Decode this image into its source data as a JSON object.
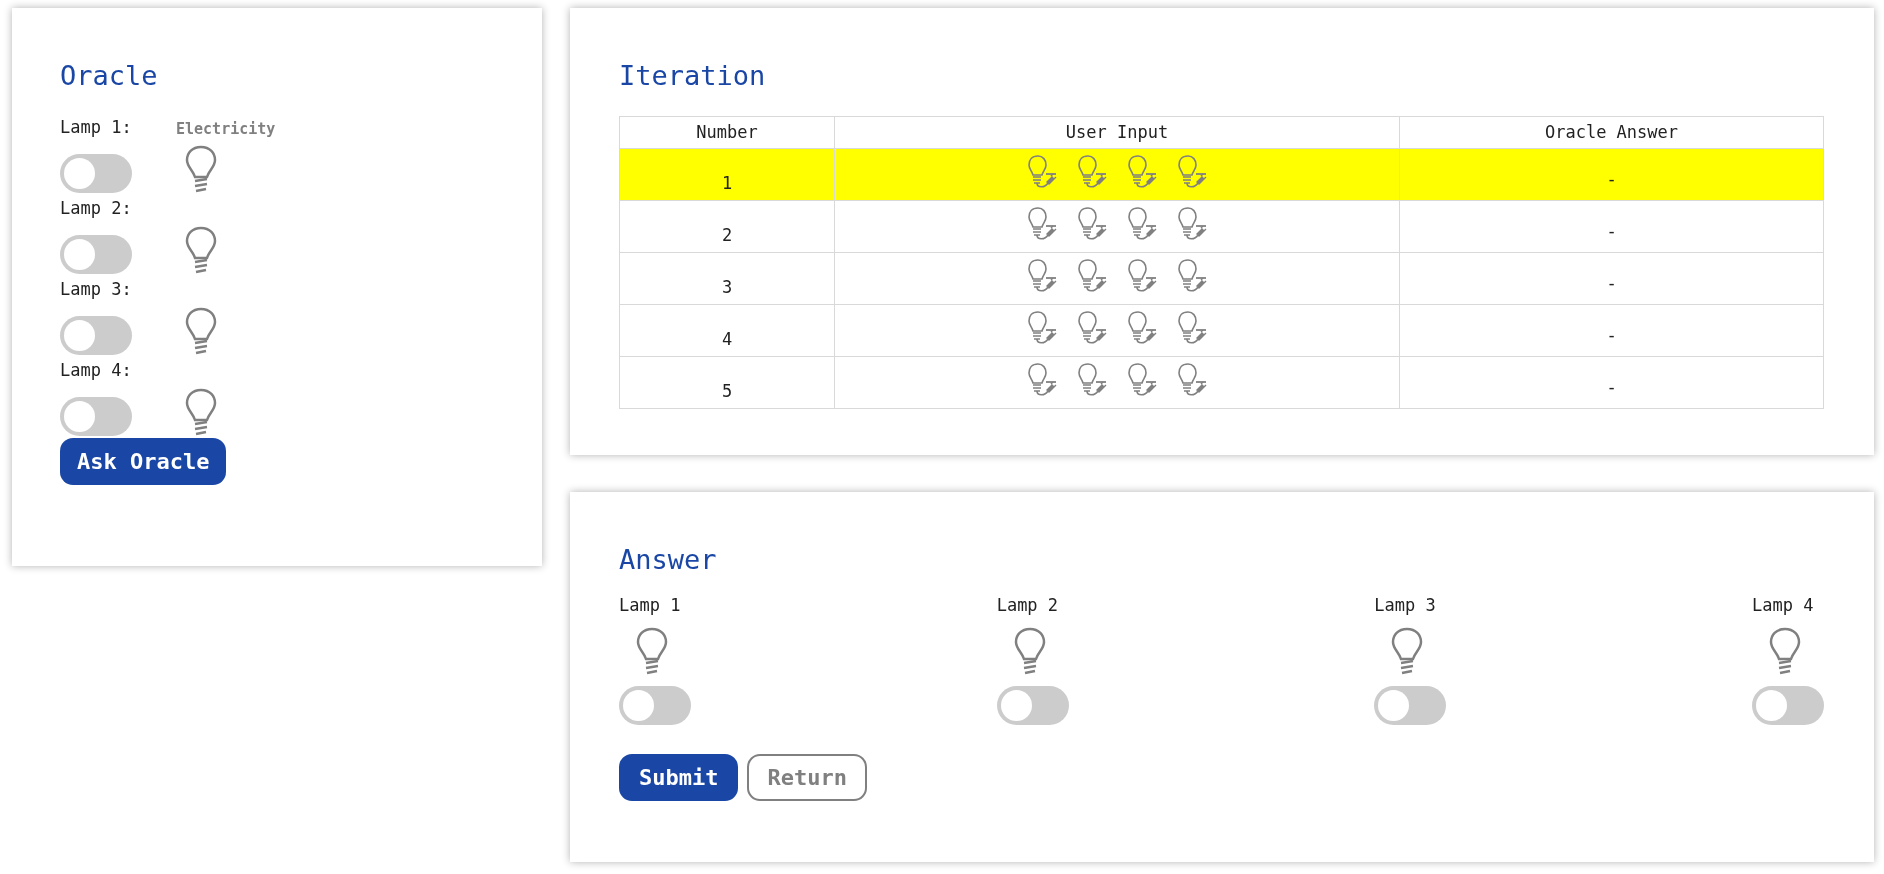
{
  "oracle": {
    "title": "Oracle",
    "electricity_label": "Electricity",
    "lamps": [
      {
        "label": "Lamp 1:",
        "on": false
      },
      {
        "label": "Lamp 2:",
        "on": false
      },
      {
        "label": "Lamp 3:",
        "on": false
      },
      {
        "label": "Lamp 4:",
        "on": false
      }
    ],
    "button": "Ask Oracle"
  },
  "iteration": {
    "title": "Iteration",
    "columns": [
      "Number",
      "User Input",
      "Oracle Answer"
    ],
    "rows": [
      {
        "number": "1",
        "selected": true,
        "user_input": [
          {
            "on": false
          },
          {
            "on": false
          },
          {
            "on": false
          },
          {
            "on": false
          }
        ],
        "oracle_answer": "-"
      },
      {
        "number": "2",
        "selected": false,
        "user_input": [
          {
            "on": false
          },
          {
            "on": false
          },
          {
            "on": false
          },
          {
            "on": false
          }
        ],
        "oracle_answer": "-"
      },
      {
        "number": "3",
        "selected": false,
        "user_input": [
          {
            "on": false
          },
          {
            "on": false
          },
          {
            "on": false
          },
          {
            "on": false
          }
        ],
        "oracle_answer": "-"
      },
      {
        "number": "4",
        "selected": false,
        "user_input": [
          {
            "on": false
          },
          {
            "on": false
          },
          {
            "on": false
          },
          {
            "on": false
          }
        ],
        "oracle_answer": "-"
      },
      {
        "number": "5",
        "selected": false,
        "user_input": [
          {
            "on": false
          },
          {
            "on": false
          },
          {
            "on": false
          },
          {
            "on": false
          }
        ],
        "oracle_answer": "-"
      }
    ]
  },
  "answer": {
    "title": "Answer",
    "lamps": [
      {
        "label": "Lamp 1",
        "on": false
      },
      {
        "label": "Lamp 2",
        "on": false
      },
      {
        "label": "Lamp 3",
        "on": false
      },
      {
        "label": "Lamp 4",
        "on": false
      }
    ],
    "buttons": [
      {
        "label": "Submit",
        "kind": "primary"
      },
      {
        "label": "Return",
        "kind": "outline"
      }
    ]
  }
}
